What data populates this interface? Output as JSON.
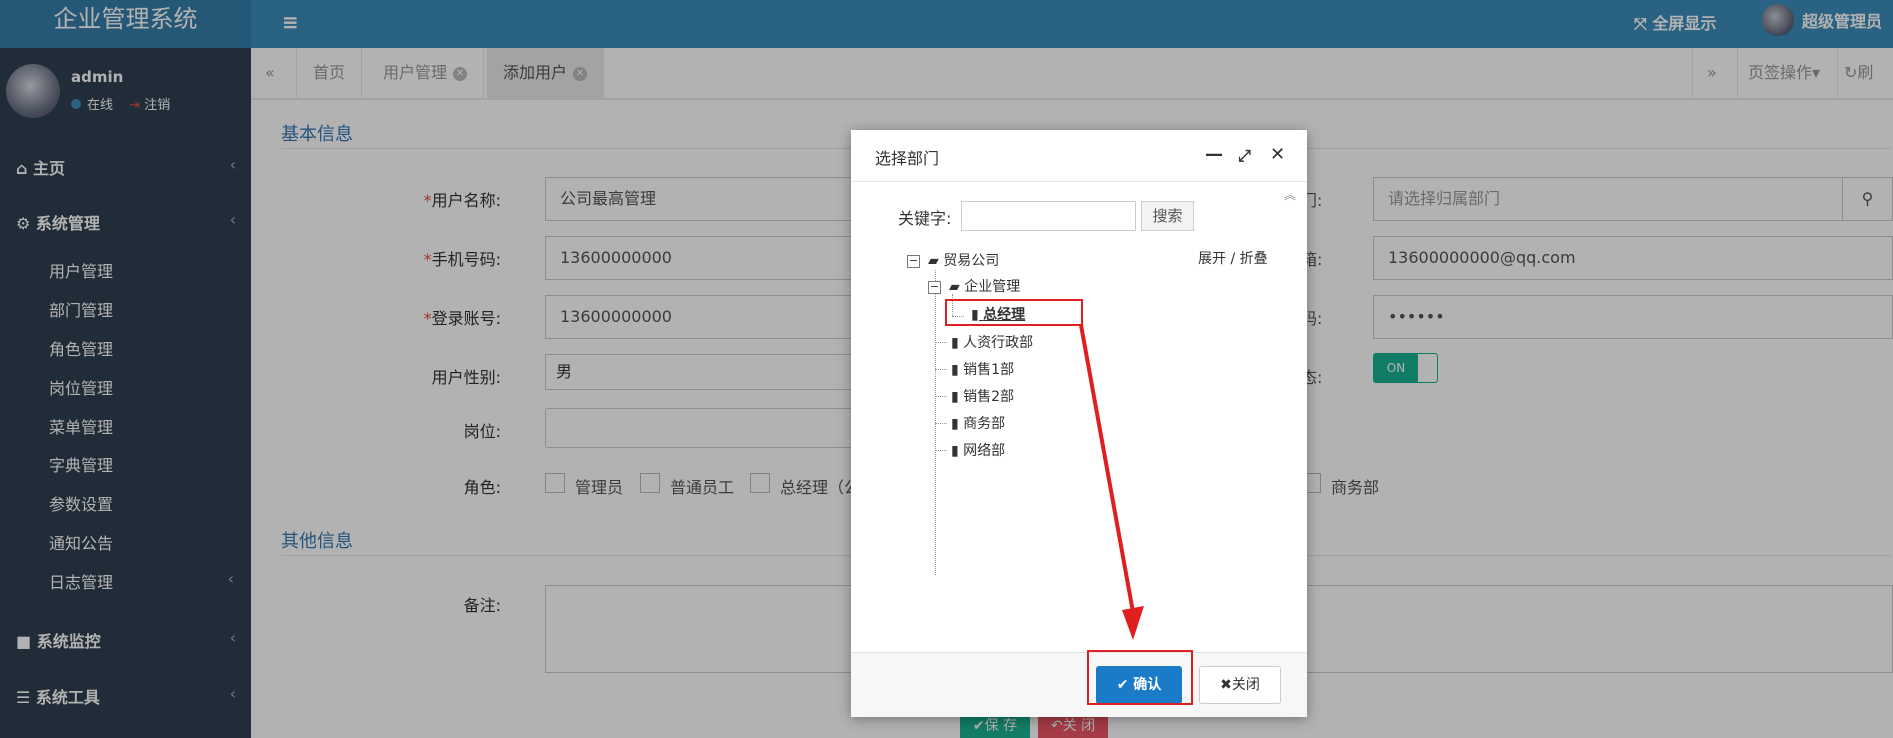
{
  "app": {
    "title": "企业管理系统",
    "fullscreen_label": "全屏显示",
    "admin_label": "超级管理员"
  },
  "sidebar": {
    "username": "admin",
    "status_online": "在线",
    "logout": "注销",
    "menus": [
      {
        "label": "主页"
      },
      {
        "label": "系统管理"
      },
      {
        "label": "系统监控"
      },
      {
        "label": "系统工具"
      }
    ],
    "submenus": [
      "用户管理",
      "部门管理",
      "角色管理",
      "岗位管理",
      "菜单管理",
      "字典管理",
      "参数设置",
      "通知公告",
      "日志管理"
    ]
  },
  "tabs": [
    {
      "label": "首页"
    },
    {
      "label": "用户管理"
    },
    {
      "label": "添加用户"
    }
  ],
  "tab_actions": {
    "page_ops": "页签操作",
    "refresh": "刷新"
  },
  "form": {
    "section_basic": "基本信息",
    "section_other": "其他信息",
    "username_label": "用户名称:",
    "username_value": "公司最高管理",
    "phone_label": "手机号码:",
    "phone_value": "13600000000",
    "login_label": "登录账号:",
    "login_value": "13600000000",
    "gender_label": "用户性别:",
    "gender_value": "男",
    "post_label": "岗位:",
    "role_label": "角色:",
    "roles": [
      "管理员",
      "普通员工",
      "总经理（公",
      "商务部"
    ],
    "dept_label_tail": "门:",
    "dept_placeholder": "请选择归属部门",
    "email_label_tail": "箱:",
    "email_value": "13600000000@qq.com",
    "pwd_label_tail": "码:",
    "pwd_value": "••••••",
    "status_label_tail": "态:",
    "status_toggle": "ON",
    "remark_label": "备注:",
    "save": "保 存",
    "cancel": "关 闭"
  },
  "dialog": {
    "title": "选择部门",
    "keyword_label": "关键字:",
    "search_btn": "搜索",
    "expand_collapse": "展开 / 折叠",
    "tree": {
      "root": "贸易公司",
      "group": "企业管理",
      "selected": "总经理",
      "items": [
        "人资行政部",
        "销售1部",
        "销售2部",
        "商务部",
        "网络部"
      ]
    },
    "ok": "确认",
    "close": "关闭"
  }
}
